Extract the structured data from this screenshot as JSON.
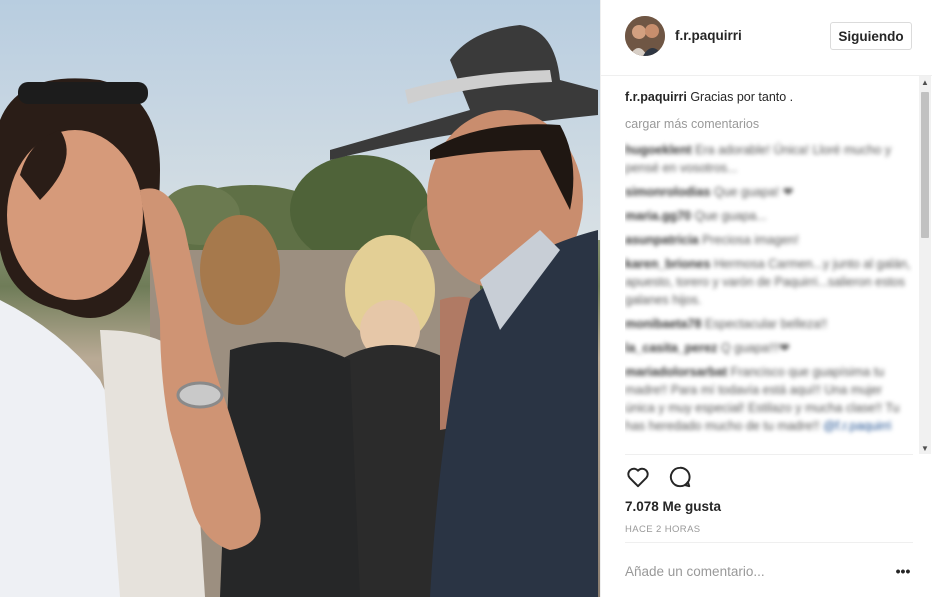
{
  "post": {
    "photo_alt": "",
    "user": {
      "username": "f.r.paquirri",
      "follow_label": "Siguiendo"
    },
    "caption": {
      "username": "f.r.paquirri",
      "text": "Gracias por tanto ."
    },
    "load_more_label": "cargar más comentarios",
    "comments": [
      {
        "user": "hugoeklent",
        "text": "Era adorable! Única! Lloré mucho y pensé en vosotros..."
      },
      {
        "user": "simonrolodias",
        "text": "Que guapa! ❤"
      },
      {
        "user": "maria.gg70",
        "text": "Que guapa..."
      },
      {
        "user": "asunpatricia",
        "text": "Preciosa imagen!"
      },
      {
        "user": "karen_briones",
        "text": "Hermosa Carmen...y junto al galán, apuesto, torero y varón de Paquirri...salieron estos galanes hijos."
      },
      {
        "user": "monibaeta78",
        "text": "Espectacular belleza!!"
      },
      {
        "user": "la_casita_perez",
        "text": "Q guapa!!!❤"
      },
      {
        "user": "mariadolorsarbat",
        "text": "Francisco que guapísima tu madre!! Para mí todavía está aquí!! Una mujer única y muy especial! Estilazo y mucha clase!! Tu has heredado mucho de tu madre!!",
        "mention": "@f.r.paquirri"
      }
    ],
    "likes_label": "7.078 Me gusta",
    "timestamp": "HACE 2 HORAS",
    "comment_placeholder": "Añade un comentario...",
    "more_label": "•••",
    "icons": {
      "like": "heart-icon",
      "comment": "comment-bubble-icon",
      "scroll_up": "scroll-up-arrow-icon",
      "scroll_down": "scroll-down-arrow-icon"
    }
  }
}
